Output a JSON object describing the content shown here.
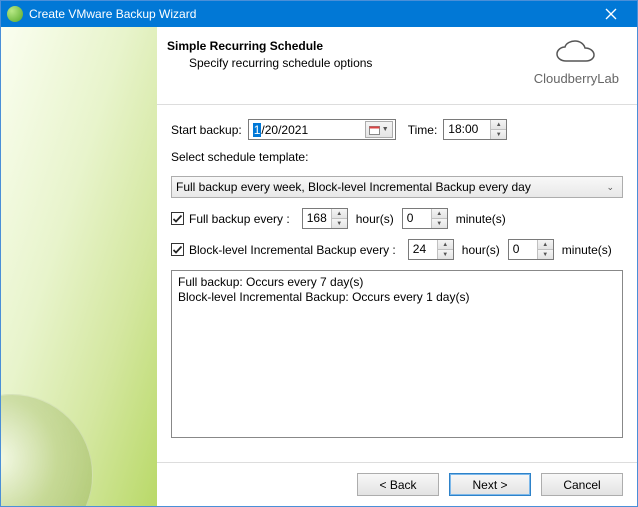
{
  "window": {
    "title": "Create VMware Backup Wizard"
  },
  "header": {
    "title": "Simple Recurring Schedule",
    "subtitle": "Specify recurring schedule options",
    "logo_text": "CloudberryLab"
  },
  "form": {
    "start_backup_label": "Start backup:",
    "start_date_highlight": "1",
    "start_date_rest": "/20/2021",
    "time_label": "Time:",
    "time_value": "18:00",
    "template_label": "Select schedule template:",
    "template_value": "Full backup every week, Block-level Incremental Backup every day",
    "full_backup_label": "Full backup every :",
    "full_hours": "168",
    "full_minutes": "0",
    "hours_unit": "hour(s)",
    "minutes_unit": "minute(s)",
    "incr_label": "Block-level Incremental Backup every :",
    "incr_hours": "24",
    "incr_minutes": "0",
    "summary_line1": "Full backup: Occurs every 7 day(s)",
    "summary_line2": "Block-level Incremental Backup: Occurs every 1 day(s)"
  },
  "buttons": {
    "back": "< Back",
    "next": "Next >",
    "cancel": "Cancel"
  }
}
